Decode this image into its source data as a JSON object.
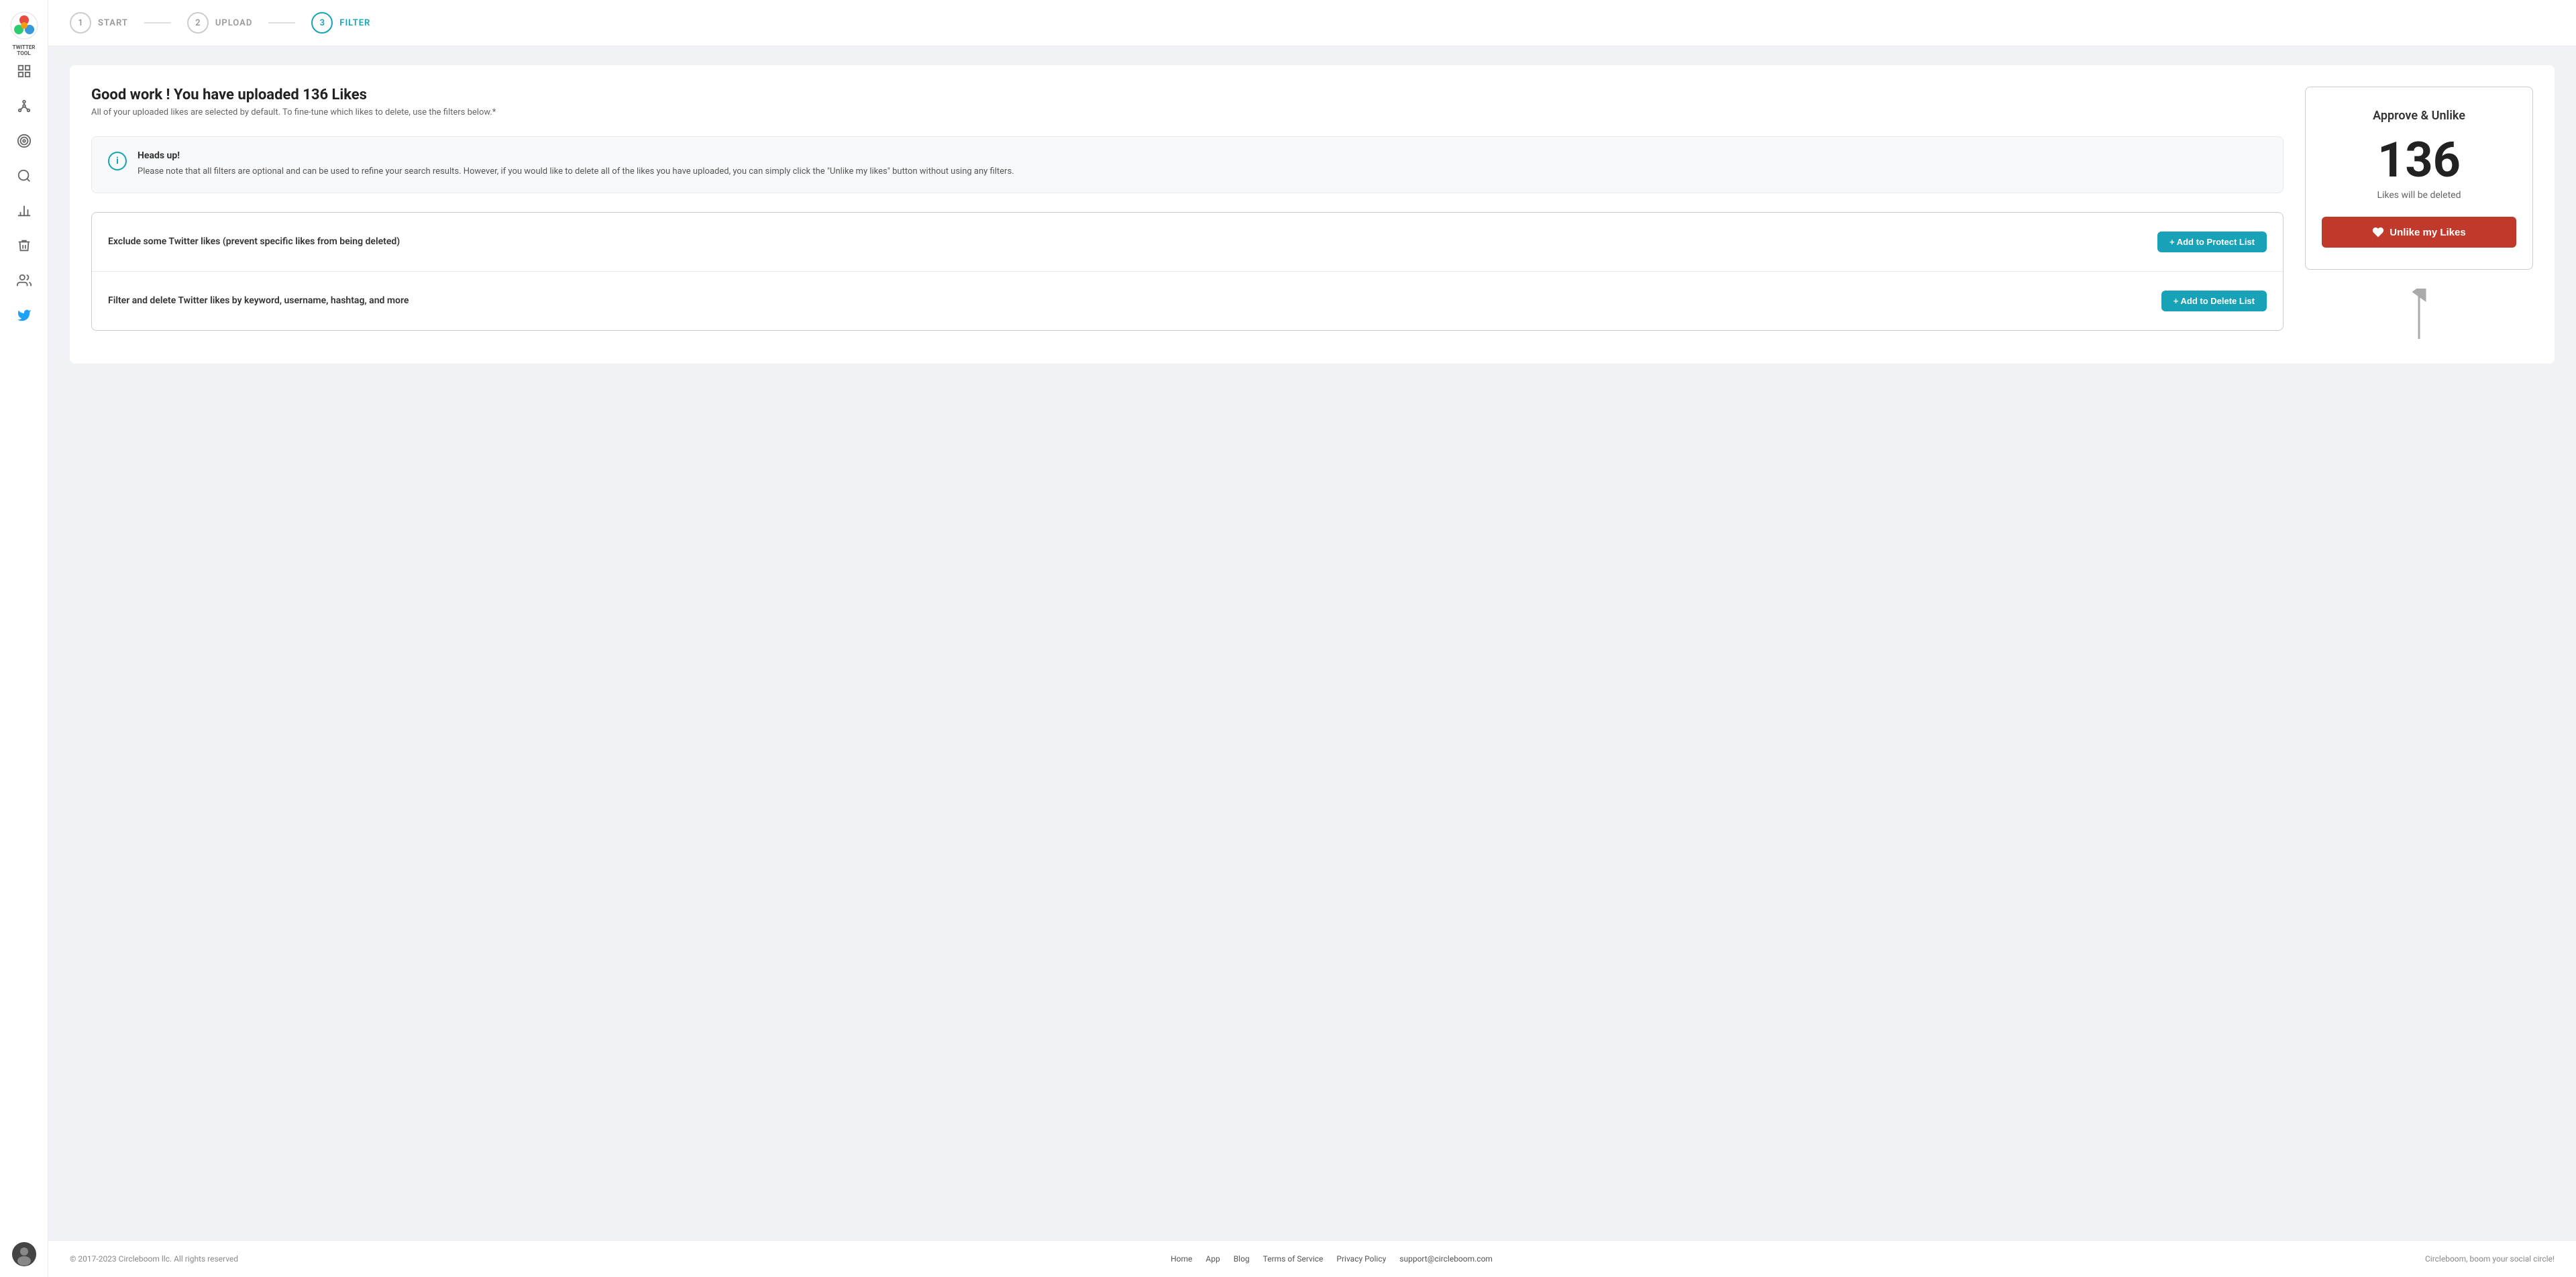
{
  "app": {
    "name": "TWITTER TOOL"
  },
  "sidebar": {
    "nav_items": [
      {
        "id": "dashboard",
        "icon": "grid",
        "label": "Dashboard"
      },
      {
        "id": "network",
        "icon": "network",
        "label": "Network"
      },
      {
        "id": "target",
        "icon": "target",
        "label": "Target"
      },
      {
        "id": "search",
        "icon": "search",
        "label": "Search"
      },
      {
        "id": "analytics",
        "icon": "bar-chart",
        "label": "Analytics"
      },
      {
        "id": "delete",
        "icon": "trash",
        "label": "Delete"
      },
      {
        "id": "audience",
        "icon": "users",
        "label": "Audience"
      },
      {
        "id": "twitter",
        "icon": "twitter",
        "label": "Twitter"
      }
    ]
  },
  "steps": [
    {
      "number": "1",
      "label": "START",
      "active": false
    },
    {
      "number": "2",
      "label": "UPLOAD",
      "active": false
    },
    {
      "number": "3",
      "label": "FILTER",
      "active": true
    }
  ],
  "page": {
    "title": "Good work ! You have uploaded 136 Likes",
    "subtitle": "All of your uploaded likes are selected by default. To fine-tune which likes to delete, use the filters below.*"
  },
  "headsup": {
    "title": "Heads up!",
    "text": "Please note that all filters are optional and can be used to refine your search results. However, if you would like to delete all of the likes you have uploaded, you can simply click the \"Unlike my likes\" button without using any filters."
  },
  "filters": [
    {
      "label": "Exclude some Twitter likes (prevent specific likes from being deleted)",
      "button": "+ Add to Protect List"
    },
    {
      "label": "Filter and delete Twitter likes by keyword, username, hashtag, and more",
      "button": "+ Add to Delete List"
    }
  ],
  "approve": {
    "title": "Approve & Unlike",
    "count": "136",
    "subtitle": "Likes will be deleted",
    "button_label": "Unlike my Likes"
  },
  "footer": {
    "copyright": "© 2017-2023 Circleboom llc. All rights reserved",
    "links": [
      {
        "label": "Home"
      },
      {
        "label": "App"
      },
      {
        "label": "Blog"
      },
      {
        "label": "Terms of Service"
      },
      {
        "label": "Privacy Policy"
      },
      {
        "label": "support@circleboom.com"
      }
    ],
    "tagline": "Circleboom, boom your social circle!"
  }
}
